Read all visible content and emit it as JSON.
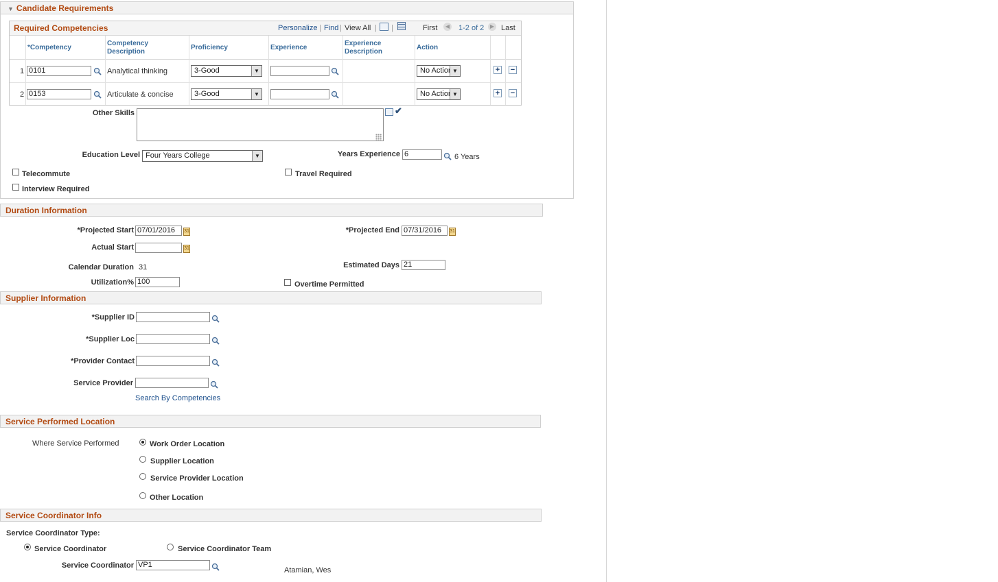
{
  "candidate": {
    "title": "Candidate Requirements",
    "grid": {
      "title": "Required Competencies",
      "nav": {
        "personalize": "Personalize",
        "find": "Find",
        "view_all": "View All",
        "first": "First",
        "range": "1-2 of 2",
        "last": "Last"
      },
      "columns": {
        "competency": "*Competency",
        "comp_desc": "Competency Description",
        "proficiency": "Proficiency",
        "experience": "Experience",
        "exp_desc": "Experience Description",
        "action": "Action"
      },
      "rows": [
        {
          "num": "1",
          "competency": "0101",
          "desc": "Analytical thinking",
          "proficiency": "3-Good",
          "experience": "",
          "action": "No Action"
        },
        {
          "num": "2",
          "competency": "0153",
          "desc": "Articulate & concise",
          "proficiency": "3-Good",
          "experience": "",
          "action": "No Action"
        }
      ]
    },
    "other_skills_label": "Other Skills",
    "education_label": "Education Level",
    "education_value": "Four Years College",
    "years_exp_label": "Years Experience",
    "years_exp_value": "6",
    "years_exp_desc": "6 Years",
    "telecommute": "Telecommute",
    "travel_required": "Travel Required",
    "interview_required": "Interview Required"
  },
  "duration": {
    "title": "Duration Information",
    "projected_start_label": "*Projected Start",
    "projected_start": "07/01/2016",
    "projected_end_label": "*Projected End",
    "projected_end": "07/31/2016",
    "actual_start_label": "Actual Start",
    "actual_start": "",
    "calendar_duration_label": "Calendar Duration",
    "calendar_duration": "31",
    "estimated_days_label": "Estimated Days",
    "estimated_days": "21",
    "utilization_label": "Utilization%",
    "utilization": "100",
    "overtime_label": "Overtime Permitted"
  },
  "supplier": {
    "title": "Supplier Information",
    "supplier_id_label": "*Supplier ID",
    "supplier_loc_label": "*Supplier Loc",
    "provider_contact_label": "*Provider Contact",
    "service_provider_label": "Service Provider",
    "search_link": "Search By Competencies"
  },
  "location": {
    "title": "Service Performed Location",
    "where_label": "Where Service Performed",
    "options": [
      "Work Order Location",
      "Supplier Location",
      "Service Provider Location",
      "Other Location"
    ],
    "selected": "Work Order Location"
  },
  "coordinator": {
    "title": "Service Coordinator Info",
    "type_label": "Service Coordinator Type:",
    "opt_coordinator": "Service Coordinator",
    "opt_team": "Service Coordinator Team",
    "coordinator_label": "Service Coordinator",
    "coordinator_value": "VP1",
    "coordinator_name": "Atamian, Wes"
  }
}
